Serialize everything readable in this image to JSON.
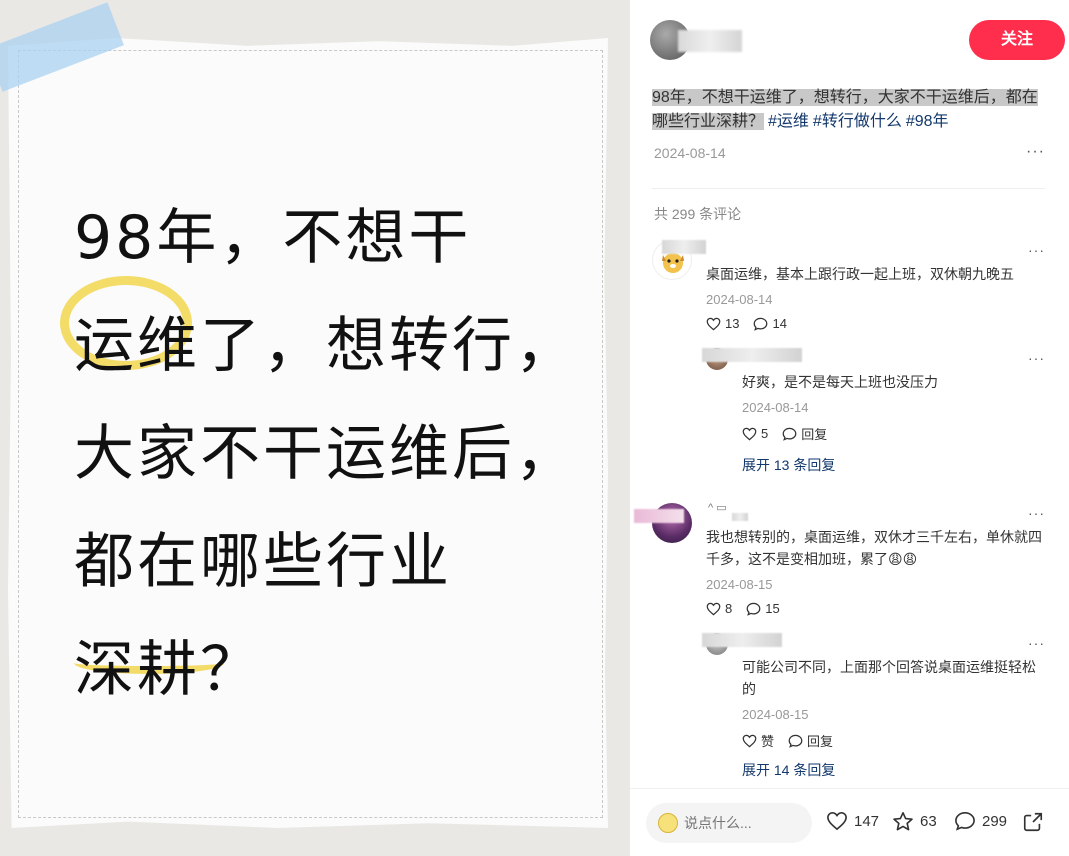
{
  "image": {
    "headline_lines": [
      "98年，不想干",
      "运维了，想转行，",
      "大家不干运维后，",
      "都在哪些行业",
      "深耕？"
    ],
    "accent_color": "#f2d64f",
    "tape_color": "#aad2f0"
  },
  "author": {
    "follow_label": "关注"
  },
  "post": {
    "highlighted_text": "98年，不想干运维了，想转行，大家不干运维后，都在哪些行业深耕？",
    "tags": [
      "#运维",
      "#转行做什么",
      "#98年"
    ],
    "date": "2024-08-14",
    "more": "···"
  },
  "comments": {
    "total_label": "共 299 条评论",
    "items": [
      {
        "text": "桌面运维，基本上跟行政一起上班，双休朝九晚五",
        "date": "2024-08-14",
        "likes": "13",
        "replies": "14",
        "more": "···",
        "sub": {
          "text": "好爽，是不是每天上班也没压力",
          "date": "2024-08-14",
          "likes": "5",
          "reply_label": "回复",
          "more": "···"
        },
        "expand_label": "展开 13 条回复"
      },
      {
        "name_fragment": "^ ▭",
        "text": "我也想转别的，桌面运维，双休才三千左右，单休就四千多，这不是变相加班，累了😩😩",
        "date": "2024-08-15",
        "likes": "8",
        "replies": "15",
        "more": "···",
        "sub": {
          "text": "可能公司不同，上面那个回答说桌面运维挺轻松的",
          "date": "2024-08-15",
          "likes_label": "赞",
          "reply_label": "回复",
          "more": "···"
        },
        "expand_label": "展开 14 条回复"
      }
    ]
  },
  "bottom": {
    "input_placeholder": "说点什么...",
    "likes": "147",
    "stars": "63",
    "comments": "299"
  },
  "colors": {
    "brand_red": "#ff2e4d",
    "link_blue": "#13386c",
    "muted": "#999999"
  }
}
